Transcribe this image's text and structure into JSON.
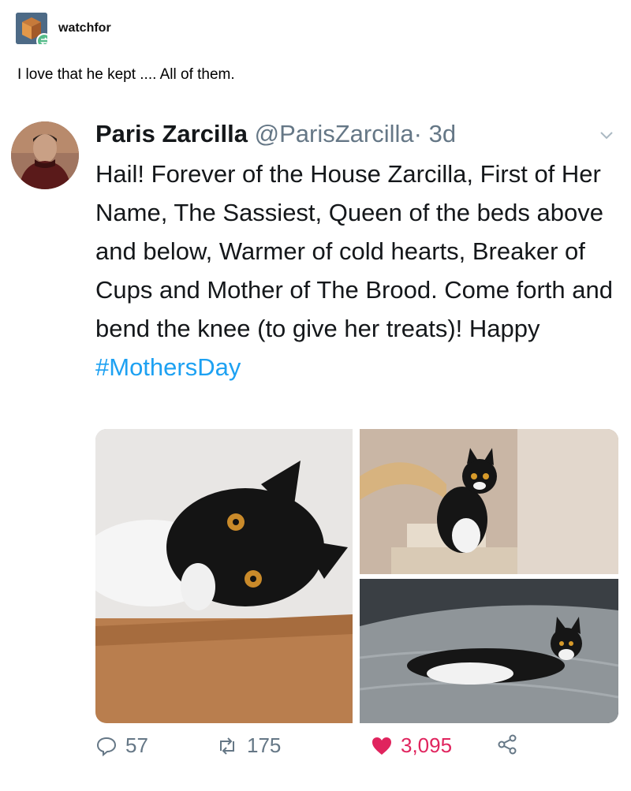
{
  "post": {
    "blog_name": "watchfor",
    "caption": "I love that he kept .... All of them."
  },
  "tweet": {
    "display_name": "Paris Zarcilla",
    "handle": "@ParisZarcilla",
    "separator": "·",
    "age": "3d",
    "text": "Hail! Forever of the House Zarcilla, First of Her Name, The Sassiest, Queen of the beds above and below, Warmer of cold hearts, Breaker of Cups and Mother of The Brood. Come forth and bend the knee (to give her treats)! Happy",
    "hashtag": "#MothersDay",
    "media": [
      {
        "description": "black and white cat lying on wooden floor"
      },
      {
        "description": "black and white cat sitting on cat tree"
      },
      {
        "description": "black and white cat lying on grey blanket"
      }
    ],
    "actions": {
      "replies": "57",
      "retweets": "175",
      "likes": "3,095"
    }
  },
  "icons": [
    "cube-avatar-icon",
    "reblog-icon",
    "chevron-down-icon",
    "reply-icon",
    "retweet-icon",
    "heart-icon",
    "share-icon"
  ],
  "colors": {
    "link": "#1da1f2",
    "like": "#e0245e",
    "muted": "#657786",
    "reblog": "#56bc8a"
  }
}
